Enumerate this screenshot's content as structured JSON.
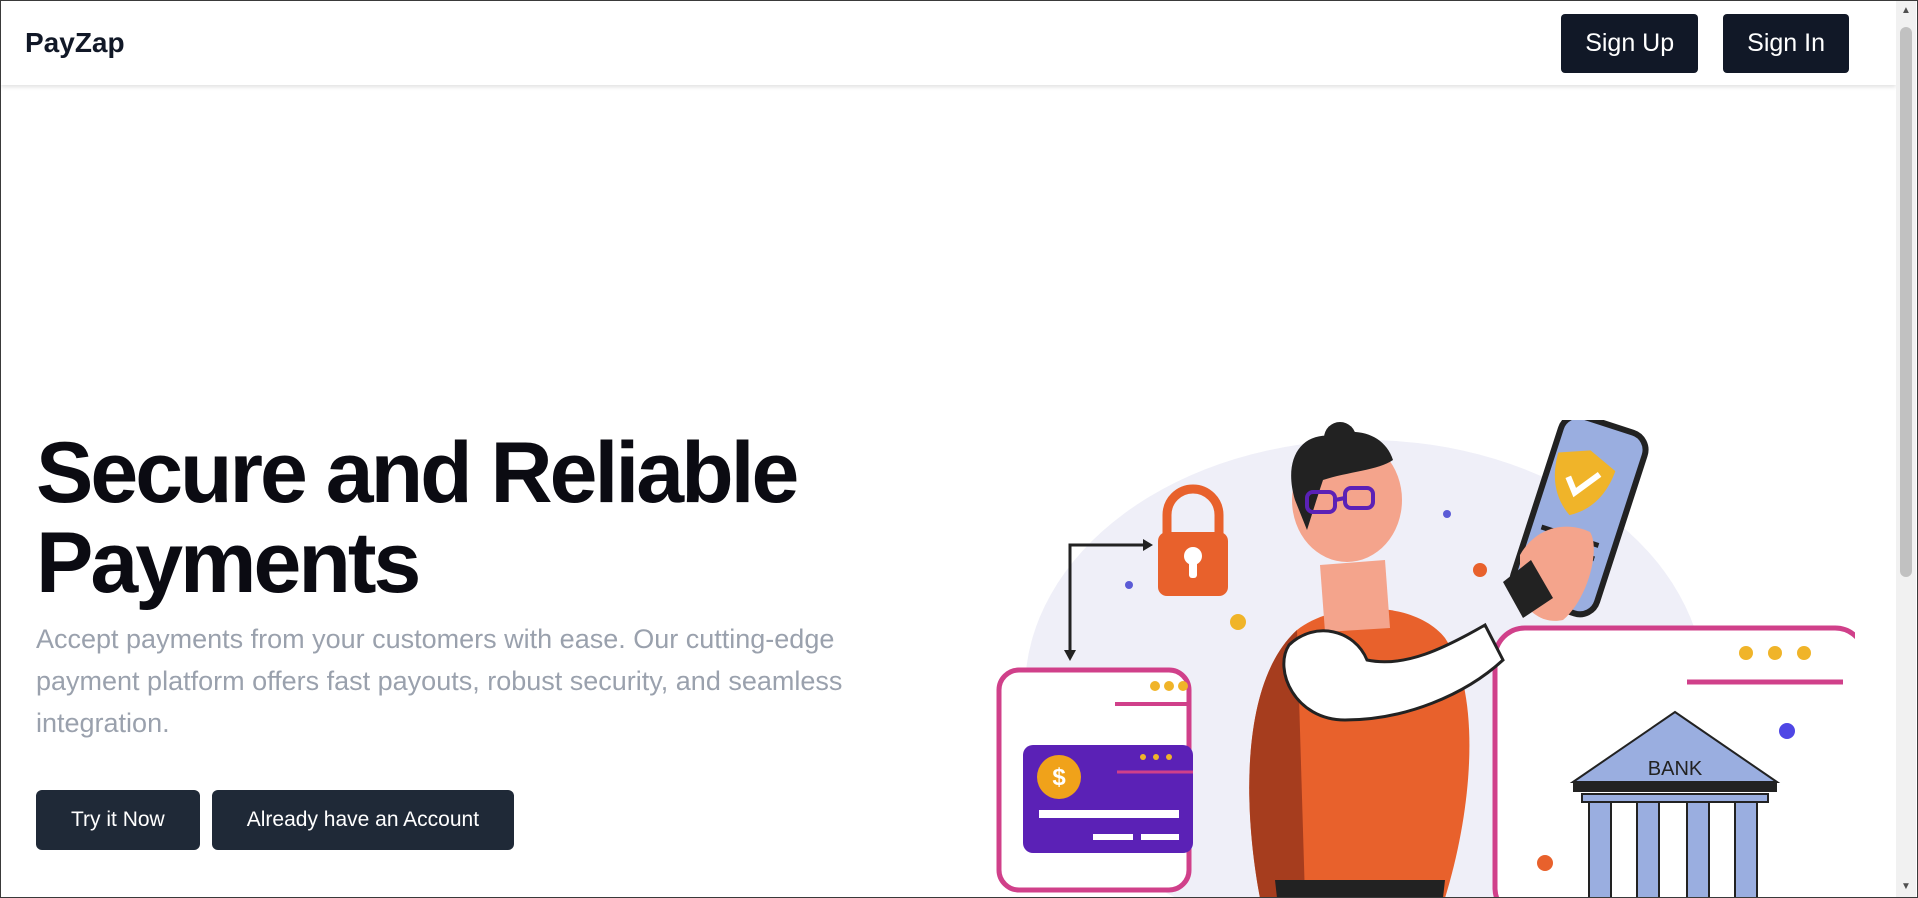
{
  "nav": {
    "brand": "PayZap",
    "signup_label": "Sign Up",
    "signin_label": "Sign In"
  },
  "hero": {
    "title": "Secure and Reliable Payments",
    "subtitle": "Accept payments from your customers with ease. Our cutting-edge payment platform offers fast payouts, robust security, and seamless integration.",
    "primary_cta": "Try it Now",
    "secondary_cta": "Already have an Account"
  },
  "illustration": {
    "bank_label": "BANK",
    "currency_symbol": "$"
  },
  "colors": {
    "primary": "#111827",
    "button": "#1f2937",
    "muted_text": "#9aa1ad",
    "accent_pink": "#d0408a",
    "accent_orange": "#e8612c",
    "accent_purple": "#5b21b6"
  }
}
